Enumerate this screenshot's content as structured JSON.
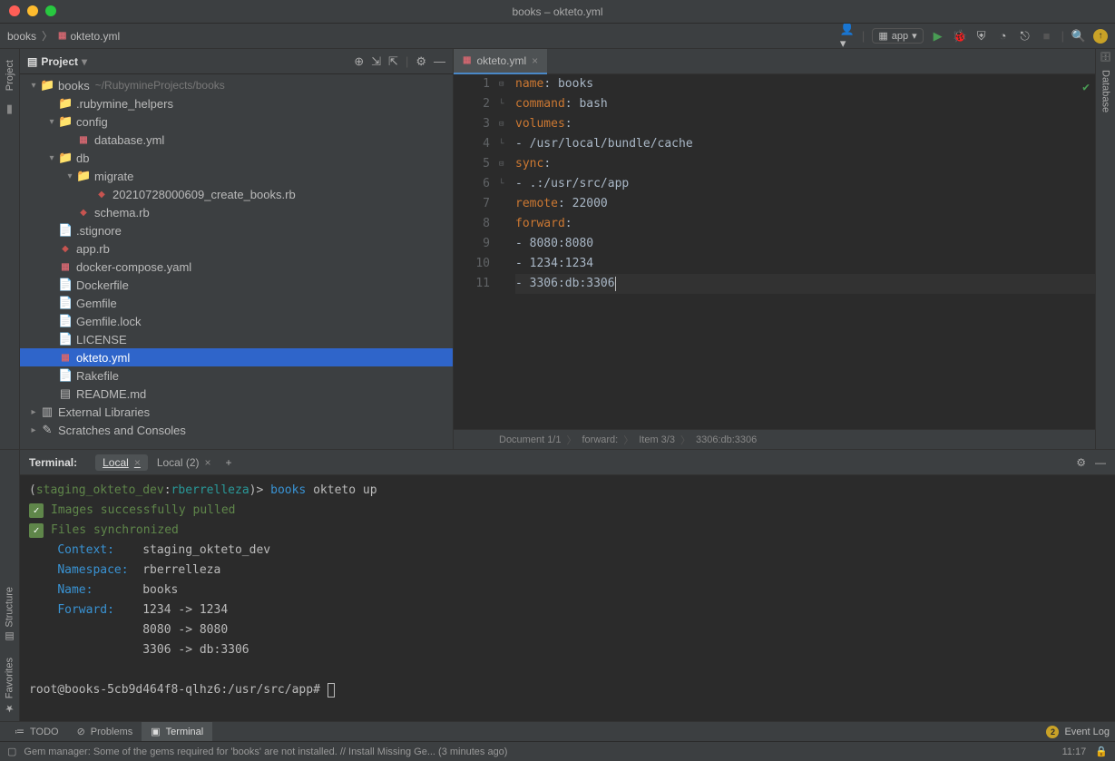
{
  "titlebar": "books – okteto.yml",
  "breadcrumb": {
    "project": "books",
    "file": "okteto.yml"
  },
  "run_config": {
    "label": "app"
  },
  "project": {
    "title": "Project",
    "root": {
      "name": "books",
      "path": "~/RubymineProjects/books"
    },
    "items": [
      {
        "depth": 0,
        "chev": "down",
        "icon": "folder",
        "name": "books",
        "suffix": "~/RubymineProjects/books"
      },
      {
        "depth": 1,
        "chev": "",
        "icon": "folder",
        "name": ".rubymine_helpers"
      },
      {
        "depth": 1,
        "chev": "down",
        "icon": "folder",
        "name": "config"
      },
      {
        "depth": 2,
        "chev": "",
        "icon": "yml",
        "name": "database.yml"
      },
      {
        "depth": 1,
        "chev": "down",
        "icon": "folder",
        "name": "db"
      },
      {
        "depth": 2,
        "chev": "down",
        "icon": "folder",
        "name": "migrate"
      },
      {
        "depth": 3,
        "chev": "",
        "icon": "rb",
        "name": "20210728000609_create_books.rb"
      },
      {
        "depth": 2,
        "chev": "",
        "icon": "rb",
        "name": "schema.rb"
      },
      {
        "depth": 1,
        "chev": "",
        "icon": "file",
        "name": ".stignore"
      },
      {
        "depth": 1,
        "chev": "",
        "icon": "rb",
        "name": "app.rb"
      },
      {
        "depth": 1,
        "chev": "",
        "icon": "yml",
        "name": "docker-compose.yaml"
      },
      {
        "depth": 1,
        "chev": "",
        "icon": "file",
        "name": "Dockerfile"
      },
      {
        "depth": 1,
        "chev": "",
        "icon": "file",
        "name": "Gemfile"
      },
      {
        "depth": 1,
        "chev": "",
        "icon": "file",
        "name": "Gemfile.lock"
      },
      {
        "depth": 1,
        "chev": "",
        "icon": "file",
        "name": "LICENSE"
      },
      {
        "depth": 1,
        "chev": "",
        "icon": "yml",
        "name": "okteto.yml",
        "selected": true
      },
      {
        "depth": 1,
        "chev": "",
        "icon": "file",
        "name": "Rakefile"
      },
      {
        "depth": 1,
        "chev": "",
        "icon": "md",
        "name": "README.md"
      },
      {
        "depth": 0,
        "chev": "right",
        "icon": "lib",
        "name": "External Libraries"
      },
      {
        "depth": 0,
        "chev": "right",
        "icon": "scratch",
        "name": "Scratches and Consoles"
      }
    ]
  },
  "editor": {
    "tab": {
      "name": "okteto.yml"
    },
    "lines": [
      {
        "n": 1,
        "fold": "",
        "k": "name",
        "c": ":",
        "v": " books"
      },
      {
        "n": 2,
        "fold": "",
        "k": "command",
        "c": ":",
        "v": " bash"
      },
      {
        "n": 3,
        "fold": "-",
        "k": "volumes",
        "c": ":",
        "v": ""
      },
      {
        "n": 4,
        "fold": "L",
        "k": "",
        "c": "",
        "v": "  - /usr/local/bundle/cache"
      },
      {
        "n": 5,
        "fold": "-",
        "k": "sync",
        "c": ":",
        "v": ""
      },
      {
        "n": 6,
        "fold": "L",
        "k": "",
        "c": "",
        "v": "  - .:/usr/src/app"
      },
      {
        "n": 7,
        "fold": "",
        "k": "remote",
        "c": ":",
        "v": " 22000"
      },
      {
        "n": 8,
        "fold": "-",
        "k": "forward",
        "c": ":",
        "v": ""
      },
      {
        "n": 9,
        "fold": "",
        "k": "",
        "c": "",
        "v": "  - 8080:8080"
      },
      {
        "n": 10,
        "fold": "",
        "k": "",
        "c": "",
        "v": "  - 1234:1234"
      },
      {
        "n": 11,
        "fold": "L",
        "k": "",
        "c": "",
        "v": "  - 3306:db:3306",
        "cursor": true
      }
    ],
    "crumbs": [
      "Document 1/1",
      "forward:",
      "Item 3/3",
      "3306:db:3306"
    ]
  },
  "terminal": {
    "title": "Terminal:",
    "tabs": [
      {
        "name": "Local",
        "active": true
      },
      {
        "name": "Local (2)"
      }
    ],
    "prompt": {
      "ctx": "staging_okteto_dev",
      "user": "rberrelleza",
      "dir": "books",
      "cmd": "okteto up"
    },
    "lines": [
      {
        "type": "check",
        "text": "Images successfully pulled"
      },
      {
        "type": "check",
        "text": "Files synchronized"
      },
      {
        "type": "kv",
        "k": "Context:",
        "v": "staging_okteto_dev"
      },
      {
        "type": "kv",
        "k": "Namespace:",
        "v": "rberrelleza"
      },
      {
        "type": "kv",
        "k": "Name:",
        "v": "books"
      },
      {
        "type": "kv",
        "k": "Forward:",
        "v": "1234 -> 1234"
      },
      {
        "type": "kv",
        "k": "",
        "v": "8080 -> 8080"
      },
      {
        "type": "kv",
        "k": "",
        "v": "3306 -> db:3306"
      }
    ],
    "shell_prompt": "root@books-5cb9d464f8-qlhz6:/usr/src/app#"
  },
  "bottom_tabs": {
    "todo": "TODO",
    "problems": "Problems",
    "terminal": "Terminal",
    "event_log": "Event Log",
    "event_count": "2"
  },
  "status_bar": {
    "msg": "Gem manager: Some of the gems required for 'books' are not installed. // Install Missing Ge... (3 minutes ago)",
    "pos": "11:17"
  },
  "left_tabs": {
    "project": "Project"
  },
  "right_tabs": {
    "database": "Database"
  },
  "vtabs": {
    "structure": "Structure",
    "favorites": "Favorites"
  }
}
